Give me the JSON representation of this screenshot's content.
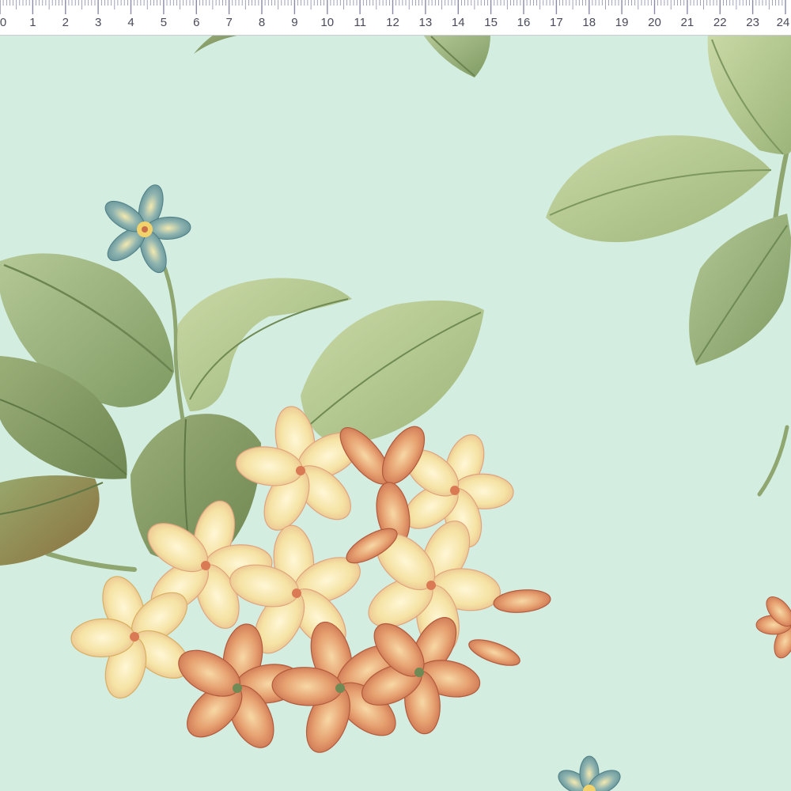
{
  "ruler": {
    "labels": [
      "0",
      "1",
      "2",
      "3",
      "4",
      "5",
      "6",
      "7",
      "8",
      "9",
      "10",
      "11",
      "12",
      "13",
      "14",
      "15",
      "16",
      "17",
      "18",
      "19",
      "20",
      "21",
      "22",
      "23",
      "24"
    ],
    "tick_color": "#8a8aa8"
  },
  "fabric": {
    "background_color": "#d4ede1",
    "motifs": [
      "green-leaf",
      "cream-frangipani-flower",
      "coral-frangipani-flower",
      "small-blue-flower"
    ]
  }
}
